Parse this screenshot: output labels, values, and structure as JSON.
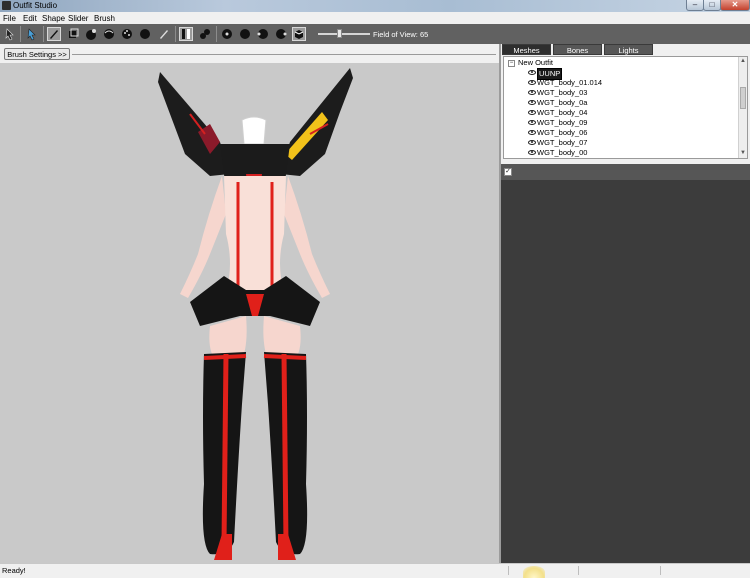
{
  "window": {
    "title": "Outfit Studio",
    "controls": [
      "–",
      "□",
      "✕"
    ]
  },
  "menu": {
    "items": [
      "File",
      "Edit",
      "Shape",
      "Slider",
      "Brush"
    ]
  },
  "toolbar": {
    "icons": [
      "select-icon",
      "brush-settings-icon",
      "standard-brush-icon",
      "deflate-brush-icon",
      "move-brush-icon",
      "smooth-brush-icon",
      "weight-brush-icon",
      "mask-brush-icon",
      "undo-brush-icon",
      "pen-icon",
      "symmetry-icon",
      "connected-icon",
      "view-front-icon",
      "view-back-icon",
      "view-left-icon",
      "view-right-icon",
      "toggle-shading-icon"
    ],
    "fov_label": "Field of View: 65",
    "fov_value": 65
  },
  "brush": {
    "settings_label": "Brush Settings >>"
  },
  "tabs": [
    {
      "label": "Meshes",
      "active": true
    },
    {
      "label": "Bones",
      "active": false
    },
    {
      "label": "Lights",
      "active": false
    }
  ],
  "meshes": {
    "root": "New Outfit",
    "items": [
      "UUNP",
      "WGT_body_01.014",
      "WGT_body_03",
      "WGT_body_0a",
      "WGT_body_04",
      "WGT_body_09",
      "WGT_body_06",
      "WGT_body_07",
      "WGT_body_00"
    ],
    "selected": "UUNP"
  },
  "sliders": {
    "checked": true
  },
  "status": {
    "text": "Ready!"
  },
  "colors": {
    "viewport": "#c9c9c9",
    "toolbar": "#616161",
    "sliders_panel": "#3c3c3c",
    "accent_red": "#e0201a"
  }
}
